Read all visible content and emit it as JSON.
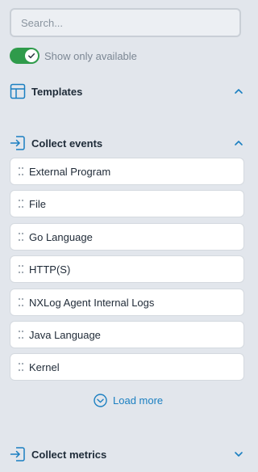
{
  "search": {
    "placeholder": "Search...",
    "value": ""
  },
  "filter": {
    "label": "Show only available",
    "enabled": true
  },
  "sections": {
    "templates": {
      "title": "Templates",
      "expanded": true
    },
    "collect_events": {
      "title": "Collect events",
      "expanded": true,
      "items": [
        {
          "label": "External Program"
        },
        {
          "label": "File"
        },
        {
          "label": "Go Language"
        },
        {
          "label": "HTTP(S)"
        },
        {
          "label": "NXLog Agent Internal Logs"
        },
        {
          "label": "Java Language"
        },
        {
          "label": "Kernel"
        }
      ],
      "load_more": "Load more"
    },
    "collect_metrics": {
      "title": "Collect metrics",
      "expanded": false
    }
  },
  "colors": {
    "accent": "#1a7fc1",
    "toggle_on": "#2f9b4b",
    "background": "#e2e6ec",
    "card": "#ffffff"
  },
  "icons": {
    "templates": "layout-icon",
    "collect_events": "sign-in-icon",
    "collect_metrics": "sign-in-icon",
    "drag": "drag-handle-icon",
    "load_more": "chevron-circle-down-icon"
  }
}
